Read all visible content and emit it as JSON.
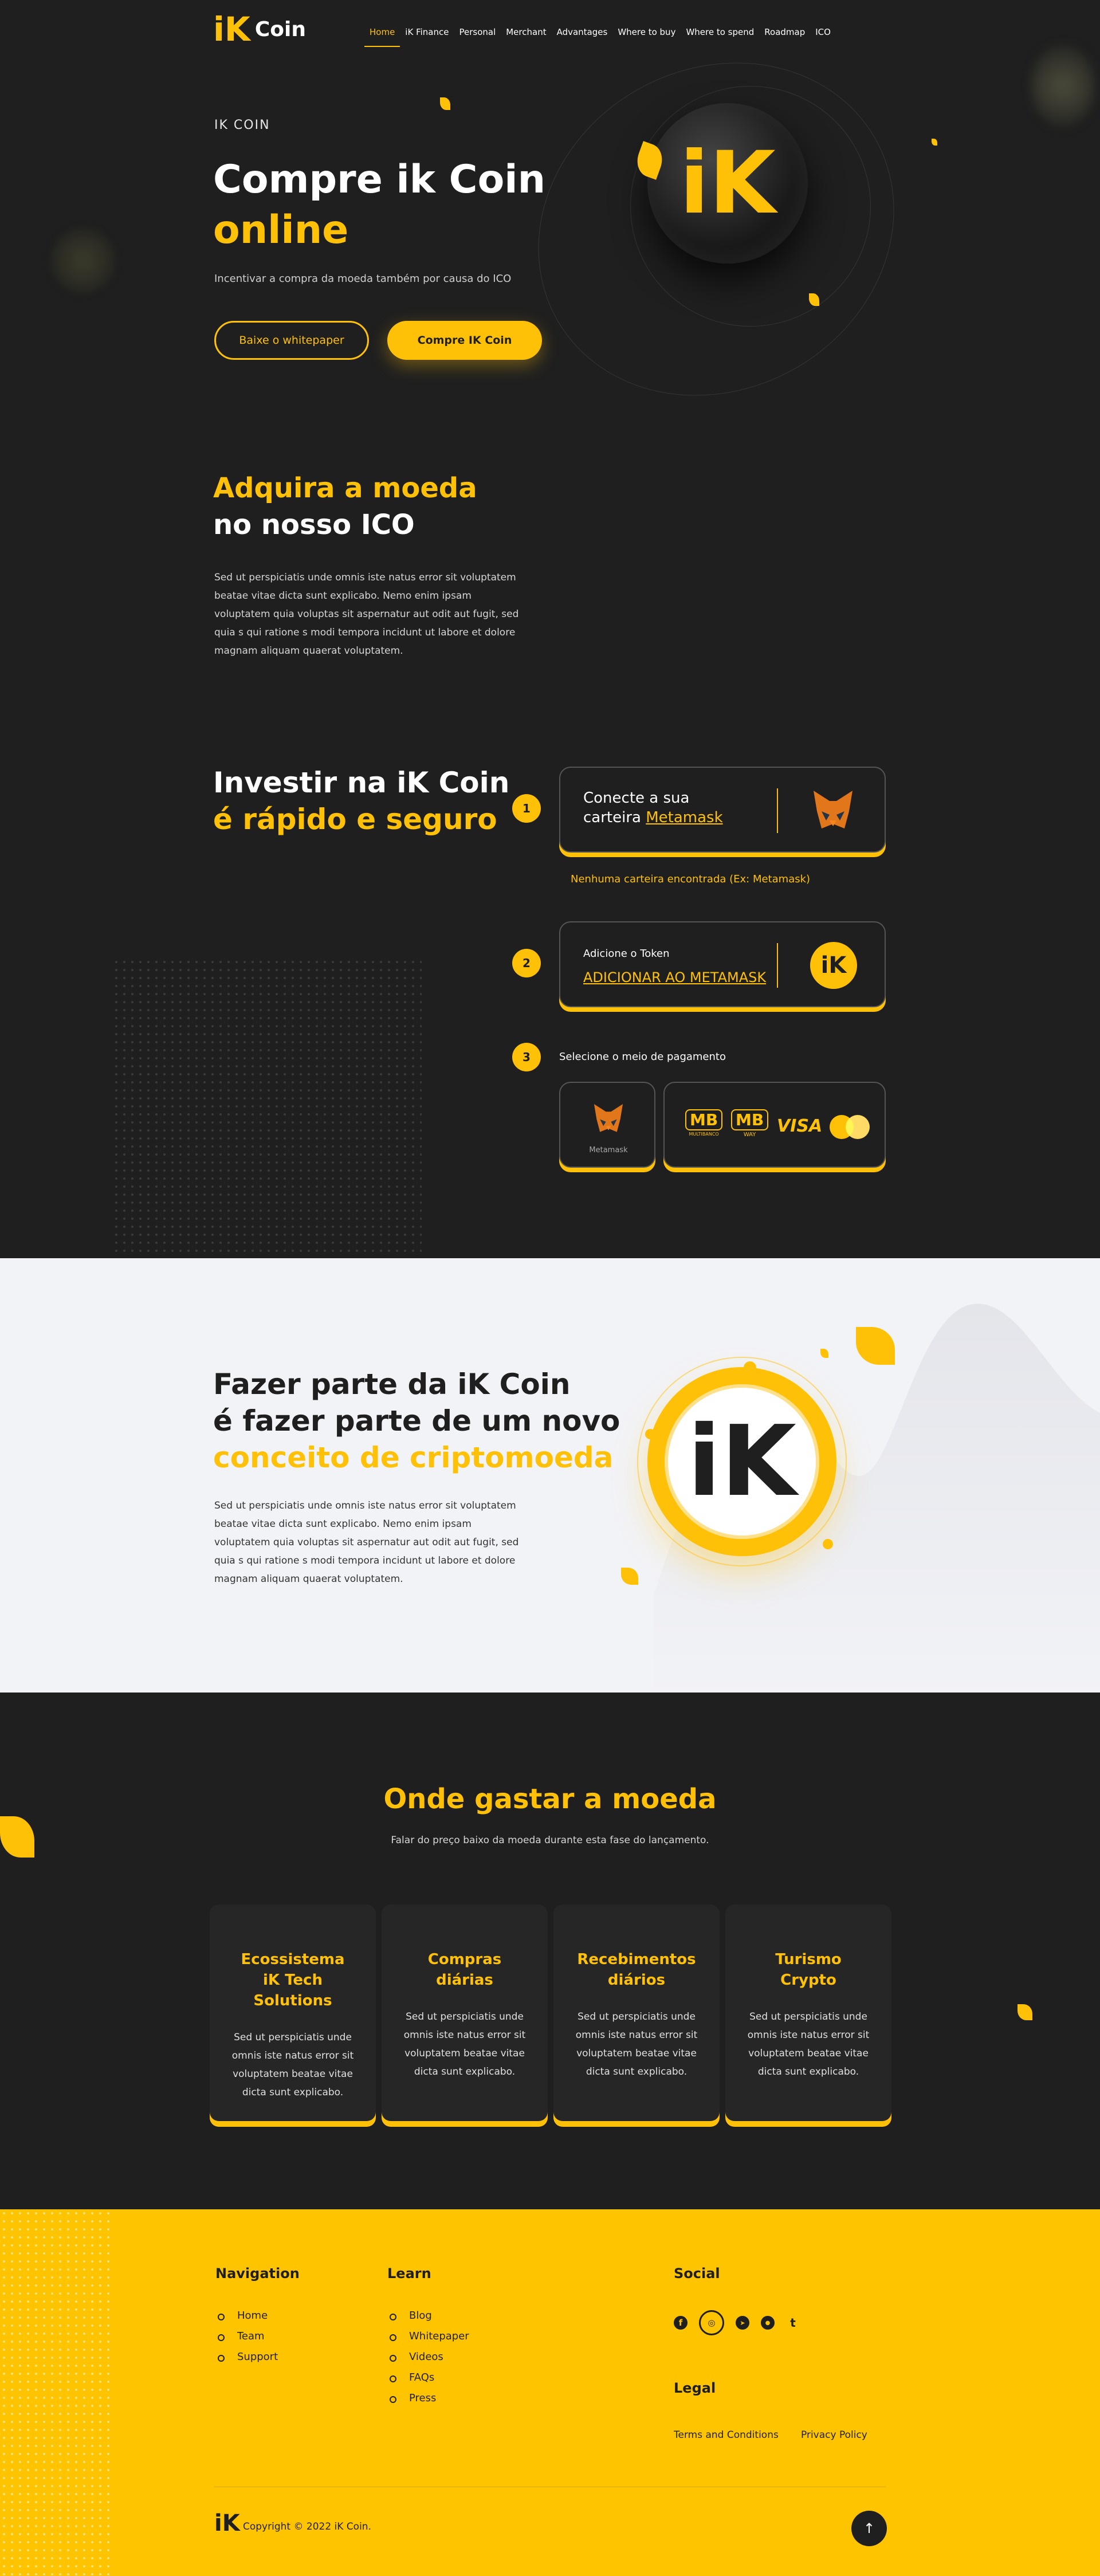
{
  "header": {
    "logo_mark": "iK",
    "logo_word": "Coin",
    "nav": [
      "Home",
      "iK Finance",
      "Personal",
      "Merchant",
      "Advantages",
      "Where to buy",
      "Where to spend",
      "Roadmap",
      "ICO"
    ]
  },
  "hero": {
    "eyebrow": "IK COIN",
    "title_line1": "Compre ik Coin",
    "title_line2": "online",
    "subtitle": "Incentivar a compra da moeda também por causa do ICO",
    "btn_whitepaper": "Baixe o whitepaper",
    "btn_buy": "Compre IK Coin",
    "coin_letter": "iK"
  },
  "ico": {
    "title_line1": "Adquira a moeda",
    "title_line2": "no nosso ICO",
    "body": "Sed ut perspiciatis unde omnis iste natus error sit voluptatem  beatae vitae dicta sunt explicabo. Nemo enim ipsam voluptatem quia voluptas sit aspernatur aut odit aut fugit, sed quia s qui ratione s modi tempora incidunt ut labore et dolore magnam aliquam quaerat voluptatem."
  },
  "invest": {
    "title_line1": "Investir na iK Coin",
    "title_line2": "é rápido e seguro",
    "step1": {
      "num": "1",
      "text_a": "Conecte a sua",
      "text_b": "carteira ",
      "link": "Metamask",
      "note": "Nenhuma carteira encontrada (Ex: Metamask)"
    },
    "step2": {
      "num": "2",
      "label": "Adicione o Token",
      "link": "ADICIONAR AO METAMASK",
      "icon_letter": "iK"
    },
    "step3": {
      "num": "3",
      "label": "Selecione o meio de pagamento",
      "metamask_label": "Metamask",
      "mb1": "MB",
      "mb1_sub": "MULTIBANCO",
      "mb2": "MB",
      "mb2_sub": "WAY",
      "visa": "VISA"
    }
  },
  "join": {
    "title_line1": "Fazer parte da iK Coin",
    "title_line2": "é fazer parte de um novo",
    "title_line3": "conceito de criptomoeda",
    "body": "Sed ut perspiciatis unde omnis iste natus error sit voluptatem  beatae vitae dicta sunt explicabo. Nemo enim ipsam voluptatem quia voluptas sit aspernatur aut odit aut fugit, sed quia s qui ratione s modi tempora incidunt ut labore et dolore magnam aliquam quaerat voluptatem.",
    "coin_letter": "iK"
  },
  "spend": {
    "title": "Onde gastar a moeda",
    "subtitle": "Falar do preço baixo da moeda durante esta fase do lançamento.",
    "cards": [
      {
        "line1": "Ecossistema",
        "line2": "iK Tech Solutions",
        "body": "Sed ut perspiciatis unde omnis iste natus error sit voluptatem beatae vitae dicta sunt explicabo."
      },
      {
        "line1": "Compras",
        "line2": "diárias",
        "body": "Sed ut perspiciatis unde omnis iste natus error sit voluptatem beatae vitae dicta sunt explicabo."
      },
      {
        "line1": "Recebimentos",
        "line2": "diários",
        "body": "Sed ut perspiciatis unde omnis iste natus error sit voluptatem beatae vitae dicta sunt explicabo."
      },
      {
        "line1": "Turismo",
        "line2": "Crypto",
        "body": "Sed ut perspiciatis unde omnis iste natus error sit voluptatem beatae vitae dicta sunt explicabo."
      }
    ]
  },
  "footer": {
    "nav_title": "Navigation",
    "nav_items": [
      "Home",
      "Team",
      "Support"
    ],
    "learn_title": "Learn",
    "learn_items": [
      "Blog",
      "Whitepaper",
      "Videos",
      "FAQs",
      "Press"
    ],
    "social_title": "Social",
    "social_icons": [
      "facebook-icon",
      "instagram-icon",
      "telegram-icon",
      "reddit-icon",
      "twitter-icon"
    ],
    "social_glyphs": [
      "f",
      "◎",
      "➤",
      "●",
      "t"
    ],
    "legal_title": "Legal",
    "terms": "Terms and Conditions",
    "privacy": "Privacy Policy",
    "logo_mark": "iK",
    "copyright": "Copyright © 2022 iK Coin.",
    "top_glyph": "↑"
  },
  "colors": {
    "accent": "#ffc107",
    "dark_bg": "#1f1f1f",
    "light_bg": "#f2f3f7",
    "footer_bg": "#ffc400"
  }
}
